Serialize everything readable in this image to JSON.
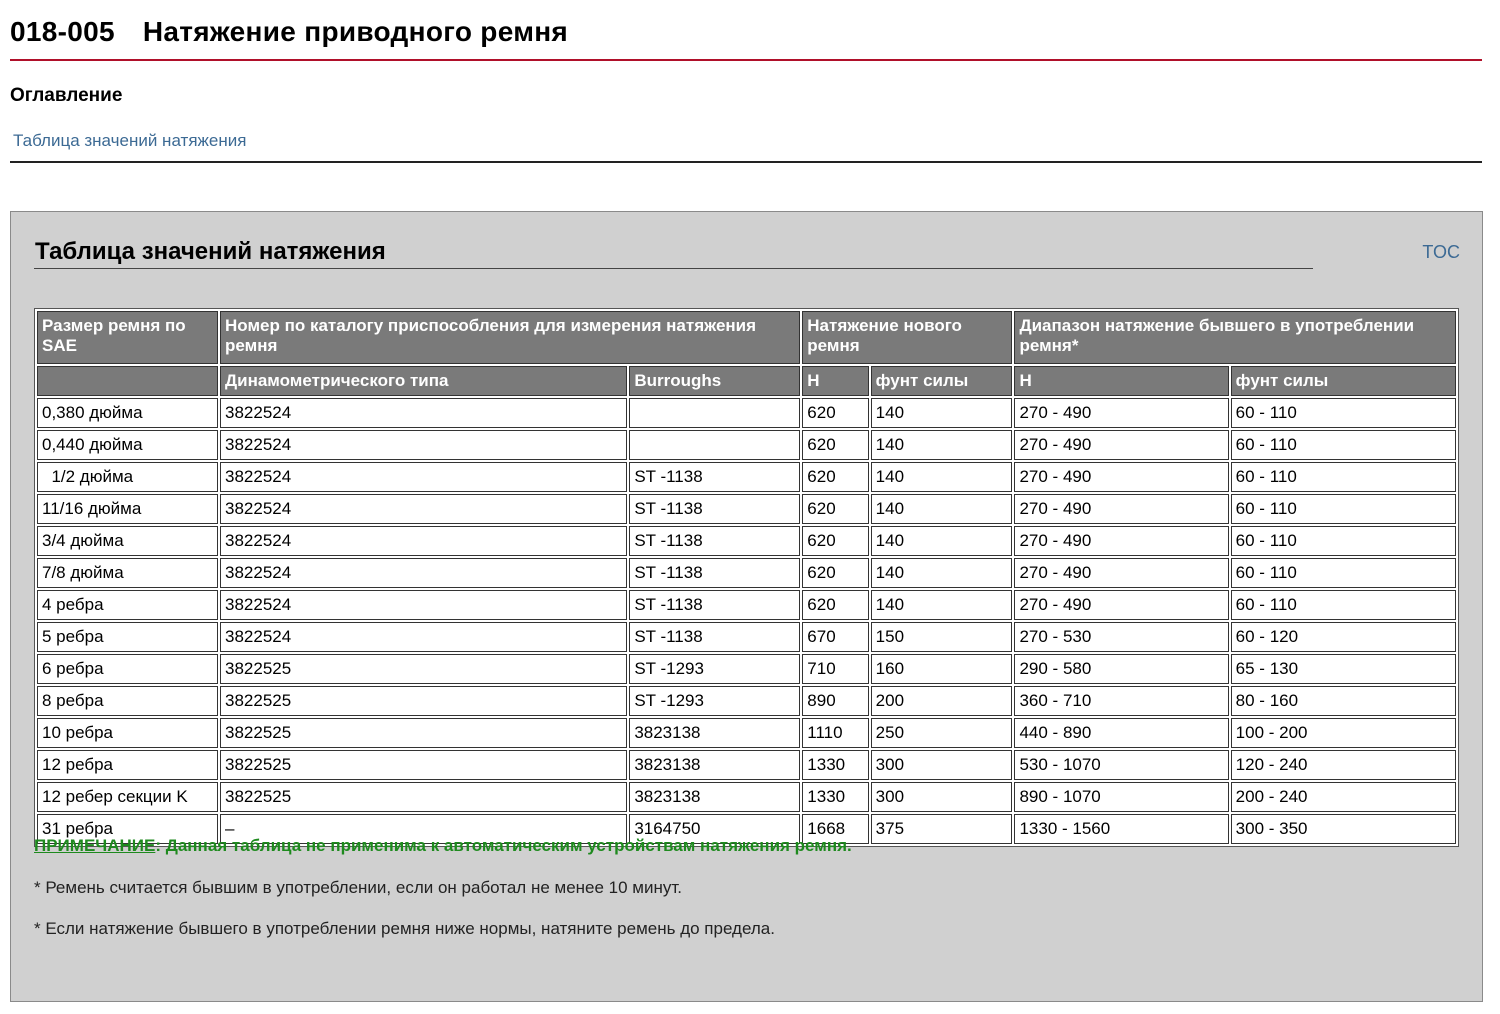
{
  "header": {
    "code": "018-005",
    "title": "Натяжение приводного ремня"
  },
  "toc": {
    "heading": "Оглавление",
    "link": "Таблица значений натяжения"
  },
  "section": {
    "title": "Таблица значений натяжения",
    "toc_link": "TOC"
  },
  "table": {
    "header_row1": [
      "Размер ремня по SAE",
      "Номер по каталогу приспособления для измерения натяжения ремня",
      "Натяжение нового ремня",
      "Диапазон натяжение бывшего в употреблении ремня*"
    ],
    "header_row2": [
      "",
      "Динамометрического типа",
      "Burroughs",
      "Н",
      "фунт силы",
      "Н",
      "фунт силы"
    ],
    "rows": [
      [
        "0,380 дюйма",
        "3822524",
        "",
        "620",
        "140",
        "270 - 490",
        "60 - 110"
      ],
      [
        "0,440 дюйма",
        "3822524",
        "",
        "620",
        "140",
        "270 - 490",
        "60 - 110"
      ],
      [
        "  1/2 дюйма",
        "3822524",
        "ST -1138",
        "620",
        "140",
        "270 - 490",
        "60 - 110"
      ],
      [
        "11/16 дюйма",
        "3822524",
        "ST -1138",
        "620",
        "140",
        "270 - 490",
        "60 - 110"
      ],
      [
        "3/4 дюйма",
        "3822524",
        "ST -1138",
        "620",
        "140",
        "270 - 490",
        "60 - 110"
      ],
      [
        "7/8 дюйма",
        "3822524",
        "ST -1138",
        "620",
        "140",
        "270 - 490",
        "60 - 110"
      ],
      [
        "4 ребра",
        "3822524",
        "ST -1138",
        "620",
        "140",
        "270 - 490",
        "60 - 110"
      ],
      [
        "5 ребра",
        "3822524",
        "ST -1138",
        "670",
        "150",
        "270 - 530",
        "60 - 120"
      ],
      [
        "6 ребра",
        "3822525",
        "ST -1293",
        "710",
        "160",
        "290 - 580",
        "65 - 130"
      ],
      [
        "8 ребра",
        "3822525",
        "ST -1293",
        "890",
        "200",
        "360 - 710",
        "80 - 160"
      ],
      [
        "10 ребра",
        "3822525",
        "3823138",
        "1110",
        "250",
        "440 - 890",
        "100 - 200"
      ],
      [
        "12 ребра",
        "3822525",
        "3823138",
        "1330",
        "300",
        "530 - 1070",
        "120 - 240"
      ],
      [
        "12 ребер секции K",
        "3822525",
        "3823138",
        "1330",
        "300",
        "890 - 1070",
        "200 - 240"
      ],
      [
        "31 ребра",
        "–",
        "3164750",
        "1668",
        "375",
        "1330 - 1560",
        "300 - 350"
      ]
    ]
  },
  "note": {
    "label": "ПРИМЕЧАНИЕ",
    "text": ": Данная таблица не применима к автоматическим устройствам натяжения ремня."
  },
  "footnotes": [
    "* Ремень считается бывшим в употреблении, если он работал не менее 10 минут.",
    "* Если натяжение бывшего в употреблении ремня ниже нормы, натяните ремень до предела."
  ]
}
